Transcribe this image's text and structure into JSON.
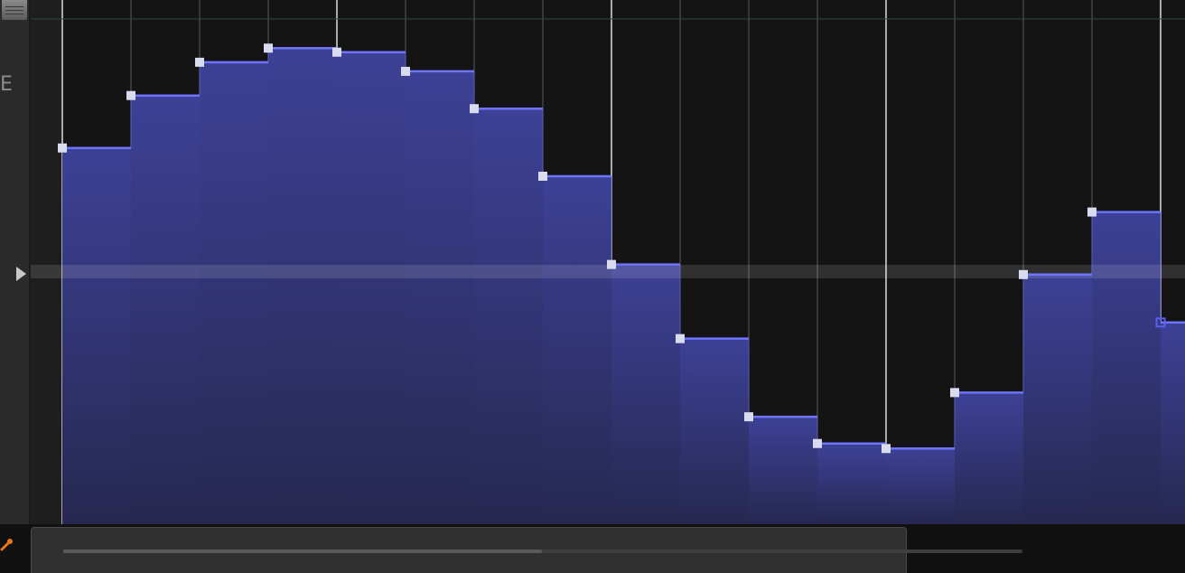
{
  "lane": {
    "label": "E"
  },
  "icons": {
    "play": "play-arrow-icon",
    "pencil": "pencil-icon",
    "scroll_grip": "grip-icon"
  },
  "colors": {
    "fill": "#3b3f8c",
    "line": "#6f74ff",
    "point": "#d9dbee",
    "selected_point": "#5a5ff0",
    "grid_major": "#dcdcdc",
    "grid_minor": "#5a5a5a",
    "pencil": "#e8761a"
  },
  "envelope": {
    "value_range": [
      0,
      1
    ],
    "center_line_value": 0.5,
    "steps": [
      {
        "value": 0.746
      },
      {
        "value": 0.85
      },
      {
        "value": 0.916
      },
      {
        "value": 0.944
      },
      {
        "value": 0.936
      },
      {
        "value": 0.898
      },
      {
        "value": 0.824
      },
      {
        "value": 0.69
      },
      {
        "value": 0.515
      },
      {
        "value": 0.368
      },
      {
        "value": 0.213
      },
      {
        "value": 0.16
      },
      {
        "value": 0.15
      },
      {
        "value": 0.261
      },
      {
        "value": 0.495
      },
      {
        "value": 0.619
      },
      {
        "value": 0.4,
        "selected": true
      }
    ]
  }
}
